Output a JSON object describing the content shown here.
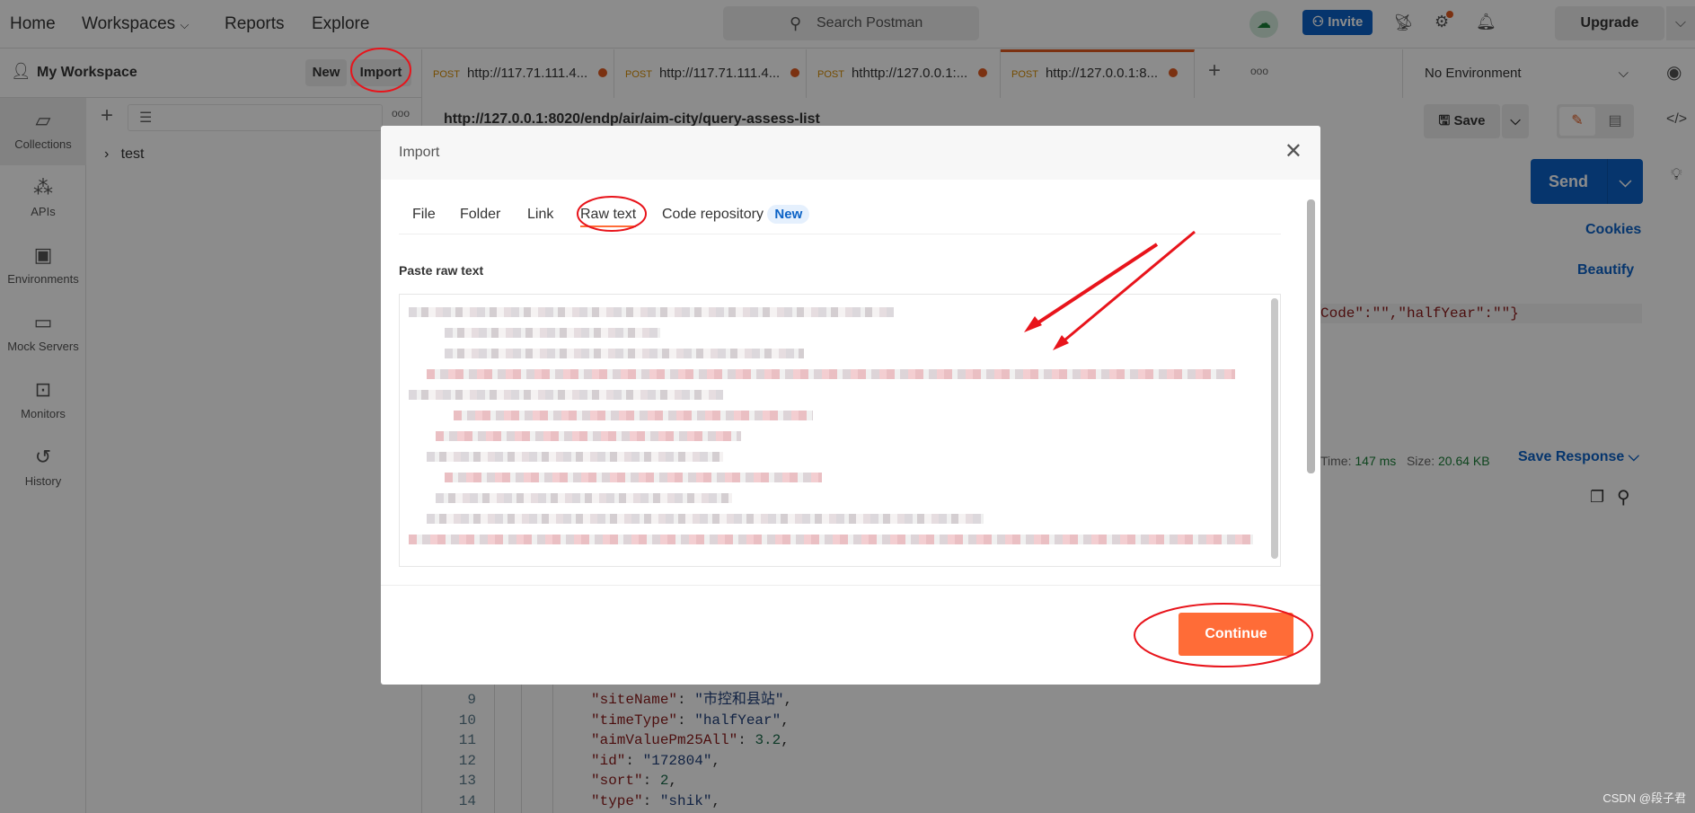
{
  "topbar": {
    "nav": [
      "Home",
      "Workspaces",
      "Reports",
      "Explore"
    ],
    "search_placeholder": "Search Postman",
    "invite": "Invite",
    "upgrade": "Upgrade",
    "colors": {
      "accent": "#ff6c37",
      "primary": "#0b62c6"
    }
  },
  "workspace": {
    "name": "My Workspace",
    "new": "New",
    "import": "Import"
  },
  "iconbar": [
    {
      "label": "Collections",
      "icon": "collections-icon"
    },
    {
      "label": "APIs",
      "icon": "apis-icon"
    },
    {
      "label": "Environments",
      "icon": "environments-icon"
    },
    {
      "label": "Mock Servers",
      "icon": "mock-servers-icon"
    },
    {
      "label": "Monitors",
      "icon": "monitors-icon"
    },
    {
      "label": "History",
      "icon": "history-icon"
    }
  ],
  "sidebar": {
    "collections": [
      "test"
    ]
  },
  "tabs": [
    {
      "method": "POST",
      "url": "http://117.71.111.4..."
    },
    {
      "method": "POST",
      "url": "http://117.71.111.4..."
    },
    {
      "method": "POST",
      "url": "hthttp://127.0.0.1:..."
    },
    {
      "method": "POST",
      "url": "http://127.0.0.1:8..."
    }
  ],
  "environment": "No Environment",
  "request": {
    "url": "http://127.0.0.1:8020/endp/air/aim-city/query-assess-list",
    "save": "Save",
    "send": "Send",
    "cookies": "Cookies",
    "beautify": "Beautify",
    "body_tail": "Code\":\"\",\"halfYear\":\"\"}"
  },
  "response": {
    "time_label": "Time:",
    "time": "147 ms",
    "size_label": "Size:",
    "size": "20.64 KB",
    "save_response": "Save Response",
    "lines": [
      {
        "n": "9",
        "k": "\"siteName\"",
        "v": "\"市控和县站\""
      },
      {
        "n": "10",
        "k": "\"timeType\"",
        "v": "\"halfYear\""
      },
      {
        "n": "11",
        "k": "\"aimValuePm25All\"",
        "v": "3.2"
      },
      {
        "n": "12",
        "k": "\"id\"",
        "v": "\"172804\""
      },
      {
        "n": "13",
        "k": "\"sort\"",
        "v": "2"
      },
      {
        "n": "14",
        "k": "\"type\"",
        "v": "\"shik\""
      }
    ]
  },
  "modal": {
    "title": "Import",
    "tabs": [
      "File",
      "Folder",
      "Link",
      "Raw text",
      "Code repository"
    ],
    "new_badge": "New",
    "active_tab": "Raw text",
    "paste_label": "Paste raw text",
    "continue": "Continue"
  },
  "watermark": "CSDN @段子君"
}
